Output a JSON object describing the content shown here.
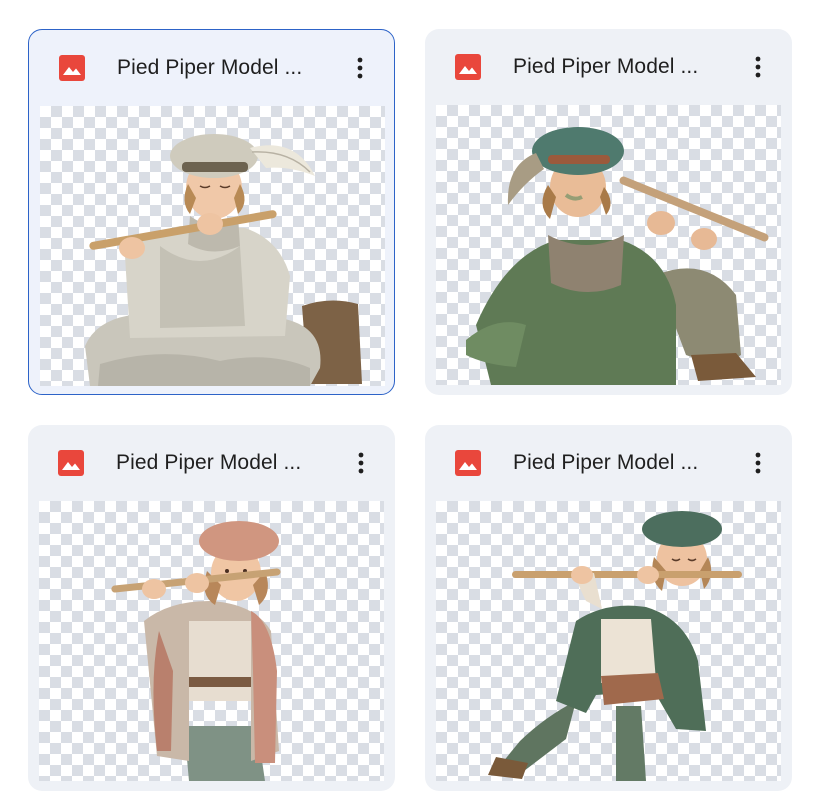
{
  "files": [
    {
      "name": "Pied Piper Model ...",
      "type_icon": "image-icon",
      "selected": true,
      "accent": "#e9473c"
    },
    {
      "name": "Pied Piper Model ...",
      "type_icon": "image-icon",
      "selected": false,
      "accent": "#e9473c"
    },
    {
      "name": "Pied Piper Model ...",
      "type_icon": "image-icon",
      "selected": false,
      "accent": "#e9473c"
    },
    {
      "name": "Pied Piper Model ...",
      "type_icon": "image-icon",
      "selected": false,
      "accent": "#e9473c"
    }
  ],
  "colors": {
    "selection_border": "#2d63c8",
    "card_background": "#eef1f6",
    "checker": "#d9dde4"
  }
}
